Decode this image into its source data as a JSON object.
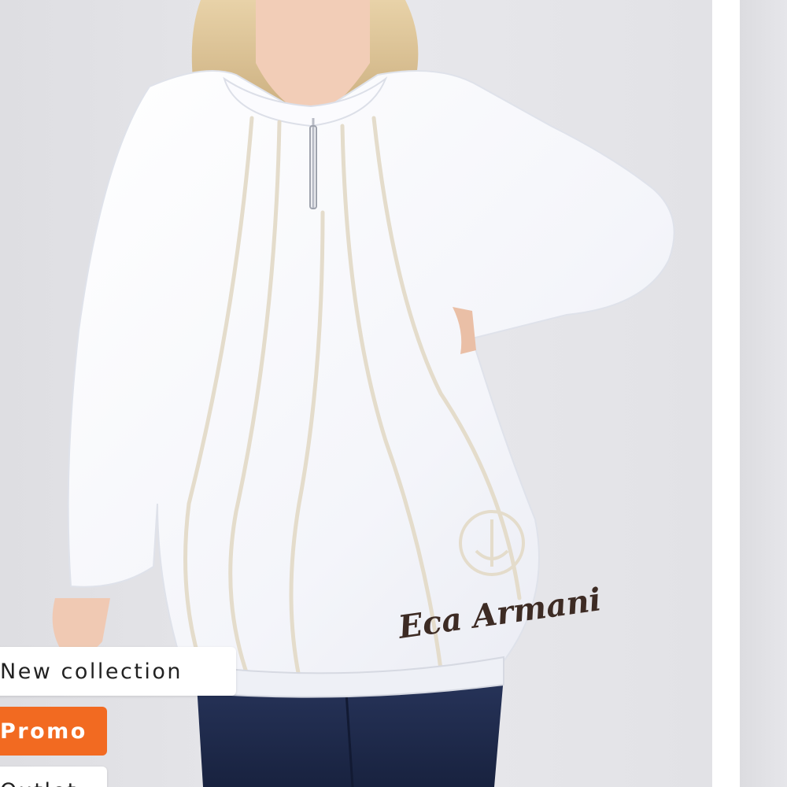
{
  "product_card": {
    "image_alt": "Woman wearing white zip-neck tunic with beige piping",
    "brand_print": "Eca Armani"
  },
  "badges": {
    "new_collection": "New collection",
    "promo": "Promo",
    "outlet": "Outlet"
  },
  "colors": {
    "promo_accent": "#f26a21",
    "background": "#e6e6ea",
    "garment": "#f7f8fc",
    "jeans": "#1f2b4d",
    "piping": "#e4dccb"
  }
}
